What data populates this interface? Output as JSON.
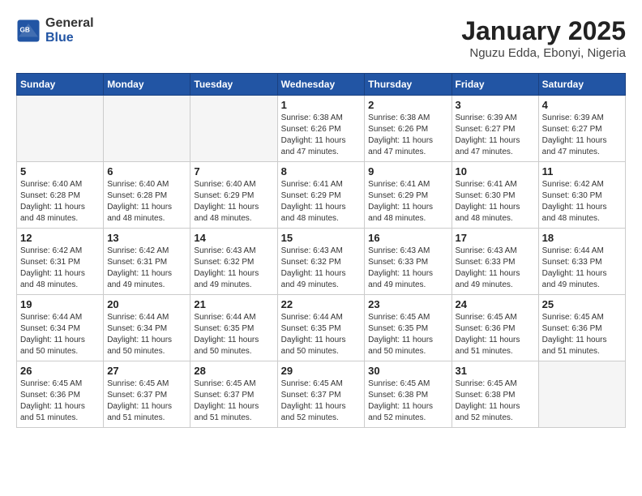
{
  "header": {
    "logo_general": "General",
    "logo_blue": "Blue",
    "title": "January 2025",
    "subtitle": "Nguzu Edda, Ebonyi, Nigeria"
  },
  "weekdays": [
    "Sunday",
    "Monday",
    "Tuesday",
    "Wednesday",
    "Thursday",
    "Friday",
    "Saturday"
  ],
  "weeks": [
    [
      {
        "num": "",
        "info": ""
      },
      {
        "num": "",
        "info": ""
      },
      {
        "num": "",
        "info": ""
      },
      {
        "num": "1",
        "info": "Sunrise: 6:38 AM\nSunset: 6:26 PM\nDaylight: 11 hours and 47 minutes."
      },
      {
        "num": "2",
        "info": "Sunrise: 6:38 AM\nSunset: 6:26 PM\nDaylight: 11 hours and 47 minutes."
      },
      {
        "num": "3",
        "info": "Sunrise: 6:39 AM\nSunset: 6:27 PM\nDaylight: 11 hours and 47 minutes."
      },
      {
        "num": "4",
        "info": "Sunrise: 6:39 AM\nSunset: 6:27 PM\nDaylight: 11 hours and 47 minutes."
      }
    ],
    [
      {
        "num": "5",
        "info": "Sunrise: 6:40 AM\nSunset: 6:28 PM\nDaylight: 11 hours and 48 minutes."
      },
      {
        "num": "6",
        "info": "Sunrise: 6:40 AM\nSunset: 6:28 PM\nDaylight: 11 hours and 48 minutes."
      },
      {
        "num": "7",
        "info": "Sunrise: 6:40 AM\nSunset: 6:29 PM\nDaylight: 11 hours and 48 minutes."
      },
      {
        "num": "8",
        "info": "Sunrise: 6:41 AM\nSunset: 6:29 PM\nDaylight: 11 hours and 48 minutes."
      },
      {
        "num": "9",
        "info": "Sunrise: 6:41 AM\nSunset: 6:29 PM\nDaylight: 11 hours and 48 minutes."
      },
      {
        "num": "10",
        "info": "Sunrise: 6:41 AM\nSunset: 6:30 PM\nDaylight: 11 hours and 48 minutes."
      },
      {
        "num": "11",
        "info": "Sunrise: 6:42 AM\nSunset: 6:30 PM\nDaylight: 11 hours and 48 minutes."
      }
    ],
    [
      {
        "num": "12",
        "info": "Sunrise: 6:42 AM\nSunset: 6:31 PM\nDaylight: 11 hours and 48 minutes."
      },
      {
        "num": "13",
        "info": "Sunrise: 6:42 AM\nSunset: 6:31 PM\nDaylight: 11 hours and 49 minutes."
      },
      {
        "num": "14",
        "info": "Sunrise: 6:43 AM\nSunset: 6:32 PM\nDaylight: 11 hours and 49 minutes."
      },
      {
        "num": "15",
        "info": "Sunrise: 6:43 AM\nSunset: 6:32 PM\nDaylight: 11 hours and 49 minutes."
      },
      {
        "num": "16",
        "info": "Sunrise: 6:43 AM\nSunset: 6:33 PM\nDaylight: 11 hours and 49 minutes."
      },
      {
        "num": "17",
        "info": "Sunrise: 6:43 AM\nSunset: 6:33 PM\nDaylight: 11 hours and 49 minutes."
      },
      {
        "num": "18",
        "info": "Sunrise: 6:44 AM\nSunset: 6:33 PM\nDaylight: 11 hours and 49 minutes."
      }
    ],
    [
      {
        "num": "19",
        "info": "Sunrise: 6:44 AM\nSunset: 6:34 PM\nDaylight: 11 hours and 50 minutes."
      },
      {
        "num": "20",
        "info": "Sunrise: 6:44 AM\nSunset: 6:34 PM\nDaylight: 11 hours and 50 minutes."
      },
      {
        "num": "21",
        "info": "Sunrise: 6:44 AM\nSunset: 6:35 PM\nDaylight: 11 hours and 50 minutes."
      },
      {
        "num": "22",
        "info": "Sunrise: 6:44 AM\nSunset: 6:35 PM\nDaylight: 11 hours and 50 minutes."
      },
      {
        "num": "23",
        "info": "Sunrise: 6:45 AM\nSunset: 6:35 PM\nDaylight: 11 hours and 50 minutes."
      },
      {
        "num": "24",
        "info": "Sunrise: 6:45 AM\nSunset: 6:36 PM\nDaylight: 11 hours and 51 minutes."
      },
      {
        "num": "25",
        "info": "Sunrise: 6:45 AM\nSunset: 6:36 PM\nDaylight: 11 hours and 51 minutes."
      }
    ],
    [
      {
        "num": "26",
        "info": "Sunrise: 6:45 AM\nSunset: 6:36 PM\nDaylight: 11 hours and 51 minutes."
      },
      {
        "num": "27",
        "info": "Sunrise: 6:45 AM\nSunset: 6:37 PM\nDaylight: 11 hours and 51 minutes."
      },
      {
        "num": "28",
        "info": "Sunrise: 6:45 AM\nSunset: 6:37 PM\nDaylight: 11 hours and 51 minutes."
      },
      {
        "num": "29",
        "info": "Sunrise: 6:45 AM\nSunset: 6:37 PM\nDaylight: 11 hours and 52 minutes."
      },
      {
        "num": "30",
        "info": "Sunrise: 6:45 AM\nSunset: 6:38 PM\nDaylight: 11 hours and 52 minutes."
      },
      {
        "num": "31",
        "info": "Sunrise: 6:45 AM\nSunset: 6:38 PM\nDaylight: 11 hours and 52 minutes."
      },
      {
        "num": "",
        "info": ""
      }
    ]
  ]
}
